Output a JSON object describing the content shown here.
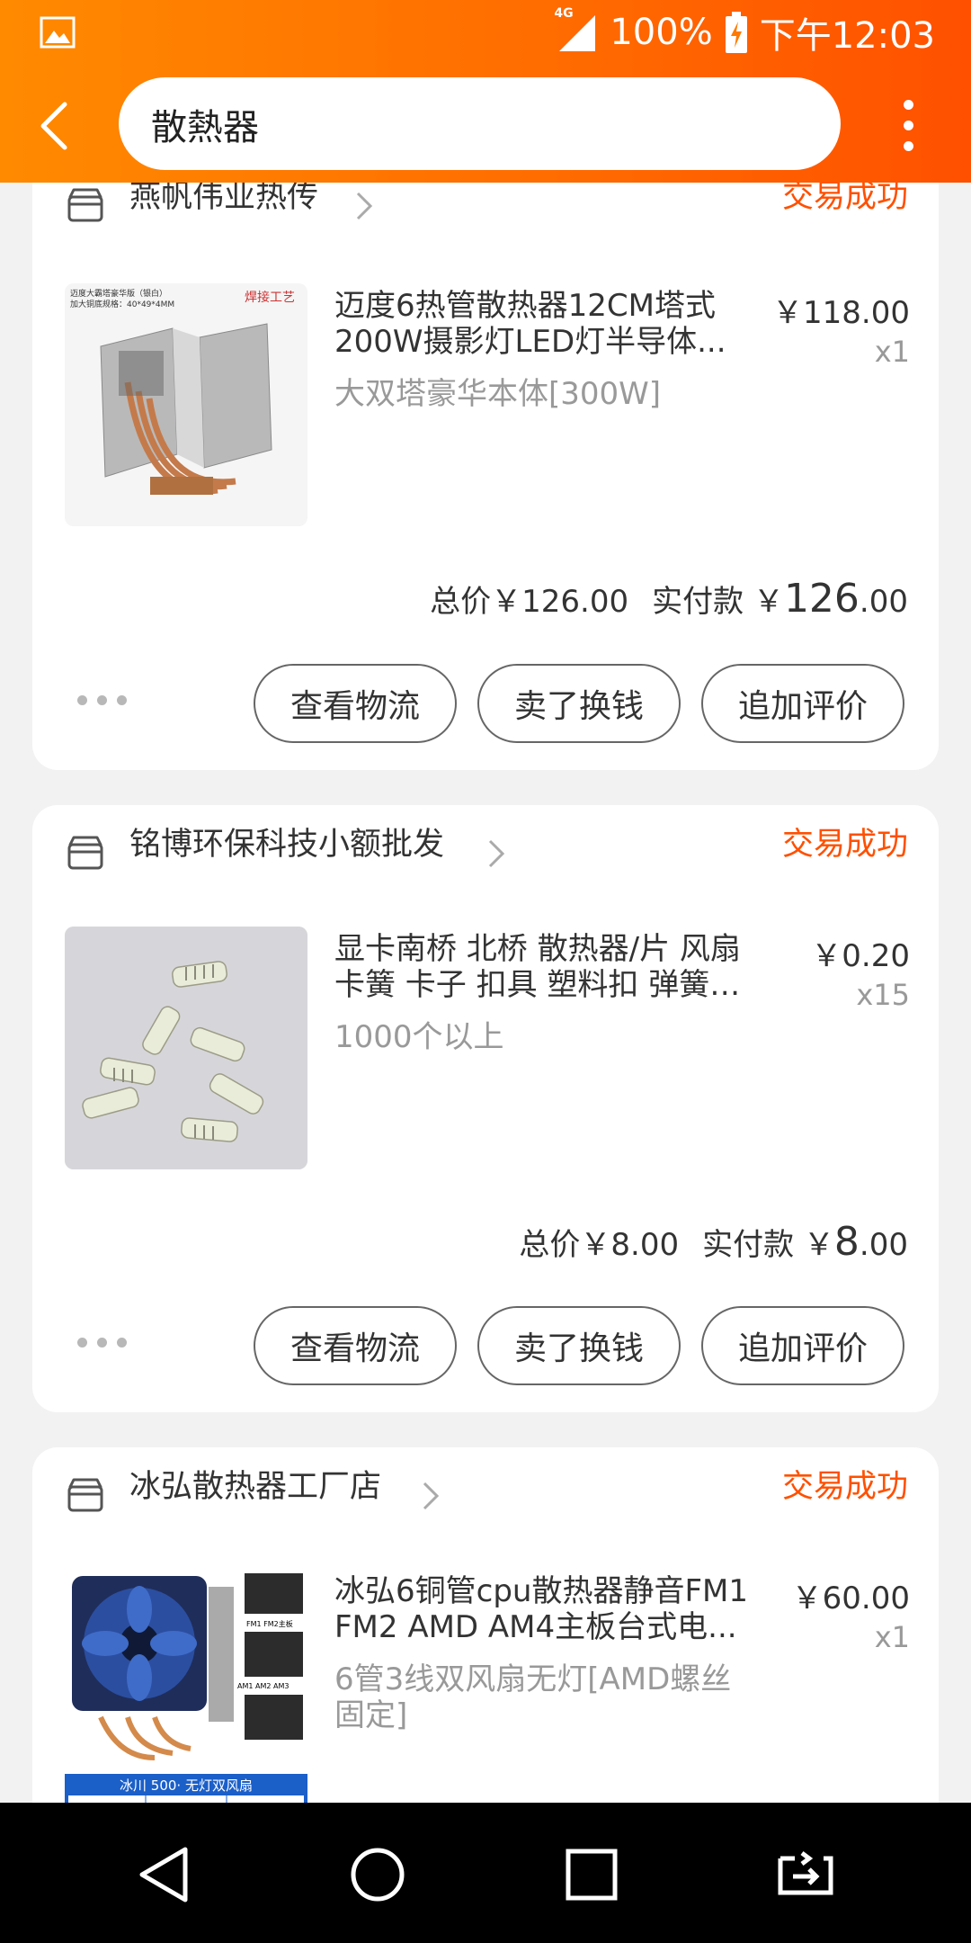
{
  "status_bar": {
    "network": "4G",
    "battery": "100%",
    "time": "下午12:03"
  },
  "header": {
    "search_text": "散熱器"
  },
  "orders": [
    {
      "shop_name": "燕帆伟业热传",
      "status": "交易成功",
      "item": {
        "title_line1": "迈度6热管散热器12CM塔式",
        "title_line2": "200W摄影灯LED灯半导体...",
        "sku": "大双塔豪华本体[300W]",
        "price": "￥118.00",
        "qty": "x1",
        "thumb_text_top": "迈度大霸塔豪华版（银白）\n加大铜底规格：40*49*4MM",
        "thumb_badge": "焊接工艺"
      },
      "total_label": "总价￥126.00",
      "paid_label": "实付款 ￥",
      "paid_int": "126",
      "paid_dec": ".00",
      "buttons": [
        "查看物流",
        "卖了换钱",
        "追加评价"
      ]
    },
    {
      "shop_name": "铭博环保科技小额批发",
      "status": "交易成功",
      "item": {
        "title_line1": "显卡南桥 北桥 散热器/片 风扇",
        "title_line2": "卡簧 卡子 扣具 塑料扣 弹簧扣...",
        "sku": "1000个以上",
        "price": "￥0.20",
        "qty": "x15"
      },
      "total_label": "总价￥8.00",
      "paid_label": "实付款 ￥",
      "paid_int": "8",
      "paid_dec": ".00",
      "buttons": [
        "查看物流",
        "卖了换钱",
        "追加评价"
      ]
    },
    {
      "shop_name": "冰弘散热器工厂店",
      "status": "交易成功",
      "item": {
        "title_line1": "冰弘6铜管cpu散热器静音FM1",
        "title_line2": "FM2 AMD AM4主板台式电...",
        "sku": "6管3线双风扇无灯[AMD螺丝固定]",
        "price": "￥60.00",
        "qty": "x1",
        "thumb_banner": "冰川 500· 无灯双风扇"
      }
    }
  ],
  "colors": {
    "accent": "#ff5000",
    "header_start": "#ff8a00",
    "header_end": "#ff5000"
  }
}
